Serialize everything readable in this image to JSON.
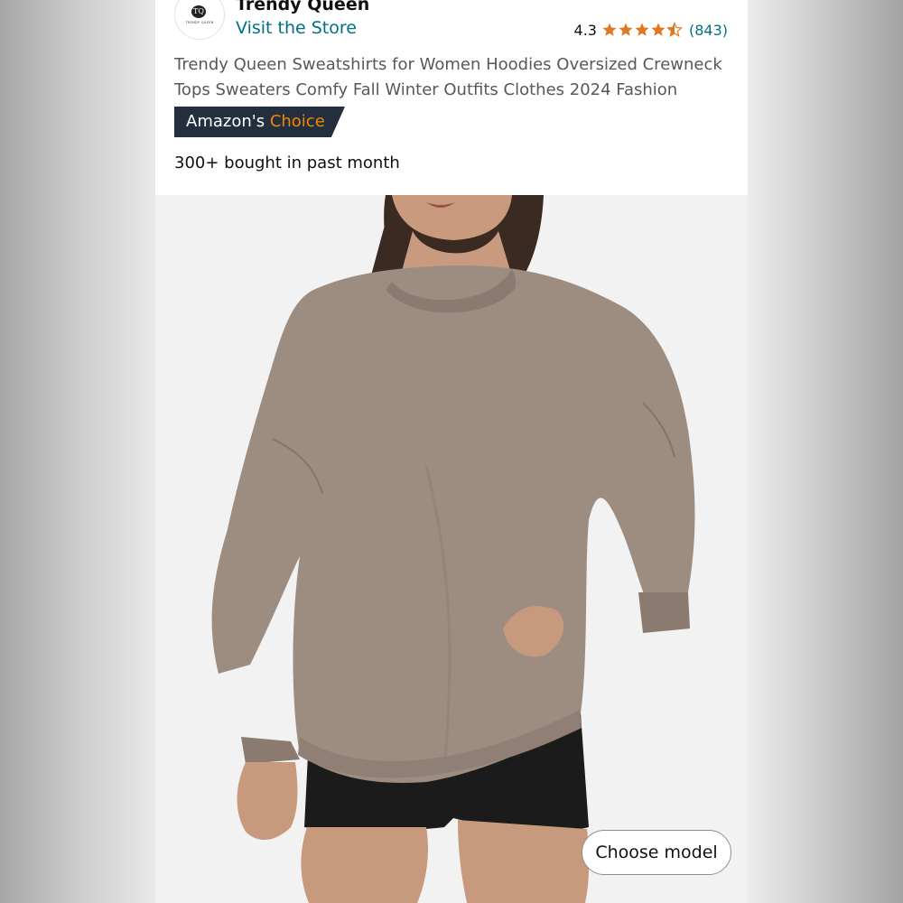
{
  "store": {
    "brand_name": "Trendy Queen",
    "visit_label": "Visit the Store",
    "logo_monogram": "TQ",
    "logo_text": "TRENDY QUEEN"
  },
  "rating": {
    "value": "4.3",
    "stars": 4.5,
    "count": "(843)"
  },
  "product": {
    "title": "Trendy Queen Sweatshirts for Women Hoodies Oversized Crewneck Tops Sweaters Comfy Fall Winter Outfits Clothes 2024 Fashion",
    "badge_prefix": "Amazon's",
    "badge_highlight": "Choice",
    "bought_text": "300+ bought in past month"
  },
  "image": {
    "icon": "product-photo-sweatshirt",
    "sweatshirt_color": "#9d8d81",
    "shorts_color": "#1b1b1b"
  },
  "buttons": {
    "choose_model": "Choose model"
  },
  "colors": {
    "link": "#007185",
    "badge_bg": "#232f3e",
    "badge_accent": "#f08804",
    "star": "#de7921"
  }
}
